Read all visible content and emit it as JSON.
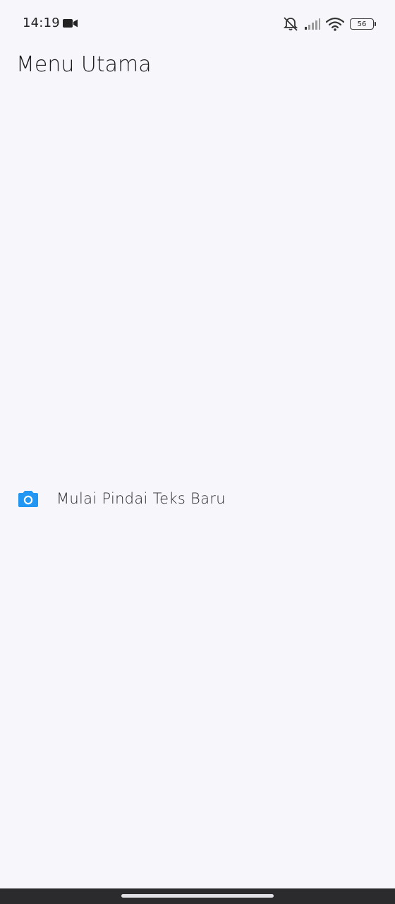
{
  "status_bar": {
    "time": "14:19",
    "battery_level": "56",
    "icons": [
      "video-camera-icon",
      "do-not-disturb-icon",
      "signal-icon",
      "wifi-icon",
      "battery-icon"
    ]
  },
  "header": {
    "title": "Menu Utama"
  },
  "menu": {
    "items": [
      {
        "label": "Mulai Pindai Teks Baru",
        "icon": "camera-icon",
        "icon_color": "#2196F3"
      }
    ]
  },
  "colors": {
    "background": "#f7f6fa",
    "accent": "#2196F3",
    "nav_bar": "#2b2b2d"
  }
}
